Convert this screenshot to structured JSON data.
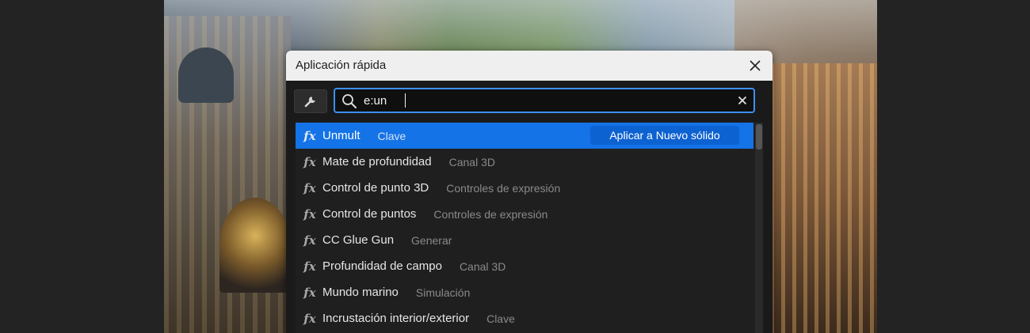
{
  "dialog": {
    "title": "Aplicación rápida",
    "close_icon": "close-icon"
  },
  "toolbar": {
    "wrench_icon": "wrench-icon",
    "search": {
      "value": "e:un",
      "icon": "search-icon",
      "clear_icon": "clear-icon"
    }
  },
  "results": {
    "selected_index": 0,
    "apply_label": "Aplicar a Nuevo sólido",
    "items": [
      {
        "icon": "fx",
        "name": "Unmult",
        "category": "Clave"
      },
      {
        "icon": "fx",
        "name": "Mate de profundidad",
        "category": "Canal 3D"
      },
      {
        "icon": "fx",
        "name": "Control de punto 3D",
        "category": "Controles de expresión"
      },
      {
        "icon": "fx",
        "name": "Control de puntos",
        "category": "Controles de expresión"
      },
      {
        "icon": "fx",
        "name": "CC Glue Gun",
        "category": "Generar"
      },
      {
        "icon": "fx",
        "name": "Profundidad de campo",
        "category": "Canal 3D"
      },
      {
        "icon": "fx",
        "name": "Mundo marino",
        "category": "Simulación"
      },
      {
        "icon": "fx",
        "name": "Incrustación interior/exterior",
        "category": "Clave"
      }
    ]
  },
  "colors": {
    "accent": "#1473e6",
    "search_border": "#3d8ff5",
    "apply_button": "#0d62d1"
  }
}
